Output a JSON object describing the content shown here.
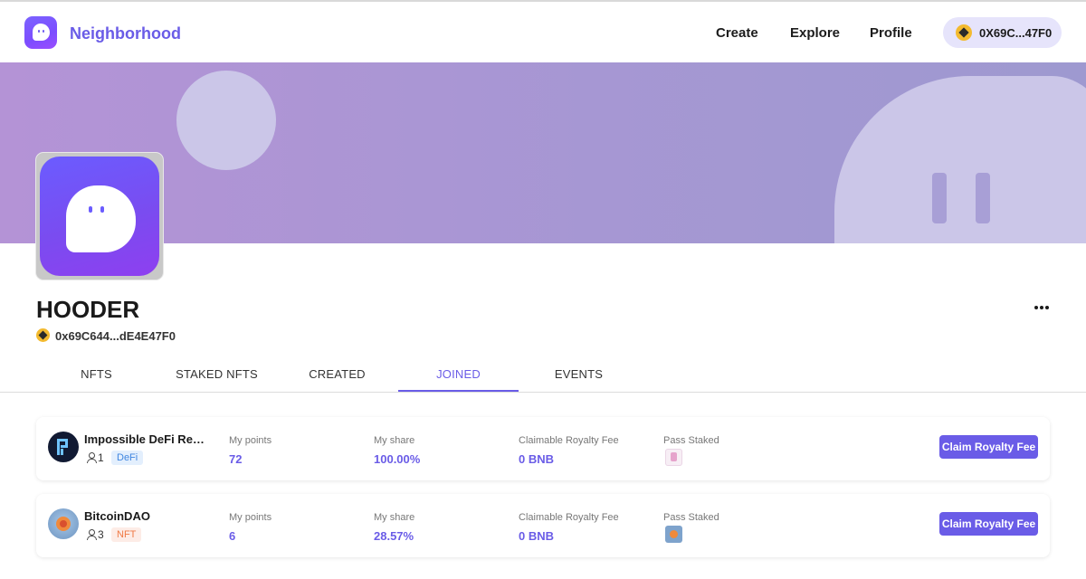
{
  "header": {
    "brand": "Neighborhood",
    "nav": [
      "Create",
      "Explore",
      "Profile"
    ],
    "wallet": {
      "address": "0X69C...47F0",
      "icon": "bnb-coin-icon"
    }
  },
  "profile": {
    "name": "HOODER",
    "address": "0x69C644...dE4E47F0",
    "more_icon": "more-horizontal-icon"
  },
  "tabs": [
    {
      "label": "NFTS",
      "active": false
    },
    {
      "label": "STAKED NFTS",
      "active": false
    },
    {
      "label": "CREATED",
      "active": false
    },
    {
      "label": "JOINED",
      "active": true
    },
    {
      "label": "EVENTS",
      "active": false
    }
  ],
  "columns": {
    "points": "My points",
    "share": "My share",
    "fee": "Claimable Royalty Fee",
    "pass": "Pass Staked"
  },
  "communities": [
    {
      "name": "Impossible DeFi Rese...",
      "members": "1",
      "tag": "DeFi",
      "points": "72",
      "share": "100.00%",
      "fee": "0 BNB",
      "button": "Claim Royalty Fee"
    },
    {
      "name": "BitcoinDAO",
      "members": "3",
      "tag": "NFT",
      "points": "6",
      "share": "28.57%",
      "fee": "0 BNB",
      "button": "Claim Royalty Fee"
    }
  ],
  "colors": {
    "accent": "#6a5ce7",
    "banner": "#a697d3",
    "wallet_pill": "#e6e4fb"
  }
}
